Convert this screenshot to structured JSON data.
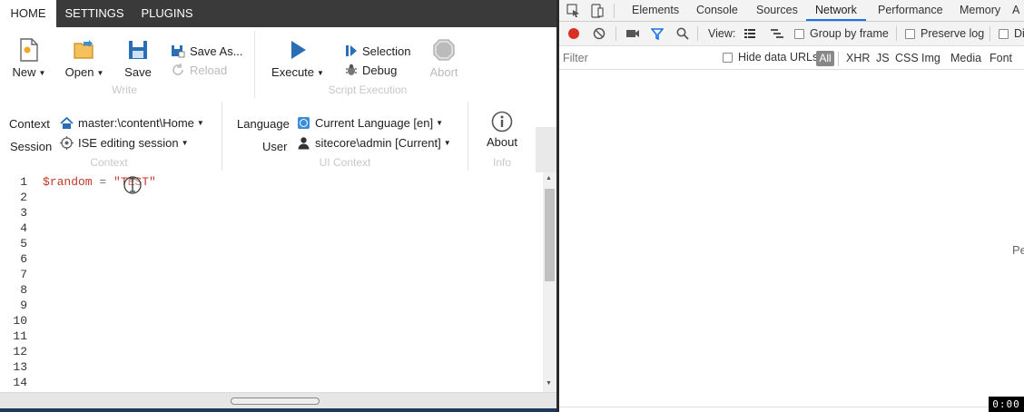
{
  "ise": {
    "tabs": [
      {
        "label": "HOME",
        "active": true
      },
      {
        "label": "SETTINGS",
        "active": false
      },
      {
        "label": "PLUGINS",
        "active": false
      }
    ],
    "write_group": {
      "label": "Write",
      "new_label": "New",
      "open_label": "Open",
      "save_label": "Save",
      "save_as_label": "Save As...",
      "reload_label": "Reload"
    },
    "script_execution_group": {
      "label": "Script Execution",
      "execute_label": "Execute",
      "selection_label": "Selection",
      "debug_label": "Debug",
      "abort_label": "Abort"
    },
    "context_group": {
      "label": "Context",
      "context_label": "Context",
      "context_value": "master:\\content\\Home",
      "session_label": "Session",
      "session_value": "ISE editing session"
    },
    "ui_context_group": {
      "label": "UI Context",
      "language_label": "Language",
      "language_value": "Current Language [en]",
      "user_label": "User",
      "user_value": "sitecore\\admin [Current]"
    },
    "info_group": {
      "label": "Info",
      "about_label": "About"
    },
    "editor": {
      "line_numbers": [
        "1",
        "2",
        "3",
        "4",
        "5",
        "6",
        "7",
        "8",
        "9",
        "10",
        "11",
        "12",
        "13",
        "14"
      ],
      "line1": {
        "var": "$random",
        "op": " = ",
        "str": "\"TEST\""
      }
    }
  },
  "devtools": {
    "tabs": [
      {
        "label": "Elements",
        "active": false
      },
      {
        "label": "Console",
        "active": false
      },
      {
        "label": "Sources",
        "active": false
      },
      {
        "label": "Network",
        "active": true
      },
      {
        "label": "Performance",
        "active": false
      },
      {
        "label": "Memory",
        "active": false
      },
      {
        "label": "A",
        "active": false
      }
    ],
    "toolbar": {
      "view_label": "View:",
      "group_by_frame": "Group by frame",
      "preserve_log": "Preserve log",
      "disable_cache_truncated": "Disa"
    },
    "filter_bar": {
      "filter_placeholder": "Filter",
      "hide_data_urls": "Hide data URLs",
      "types": [
        "All",
        "XHR",
        "JS",
        "CSS",
        "Img",
        "Media",
        "Font"
      ]
    },
    "pane_text_truncated": "Pe",
    "colors": {
      "record": "#d93025",
      "filter_active": "#1a73e8",
      "active_tab_underline": "#1a73e8"
    }
  },
  "recording_timer": "0:00"
}
